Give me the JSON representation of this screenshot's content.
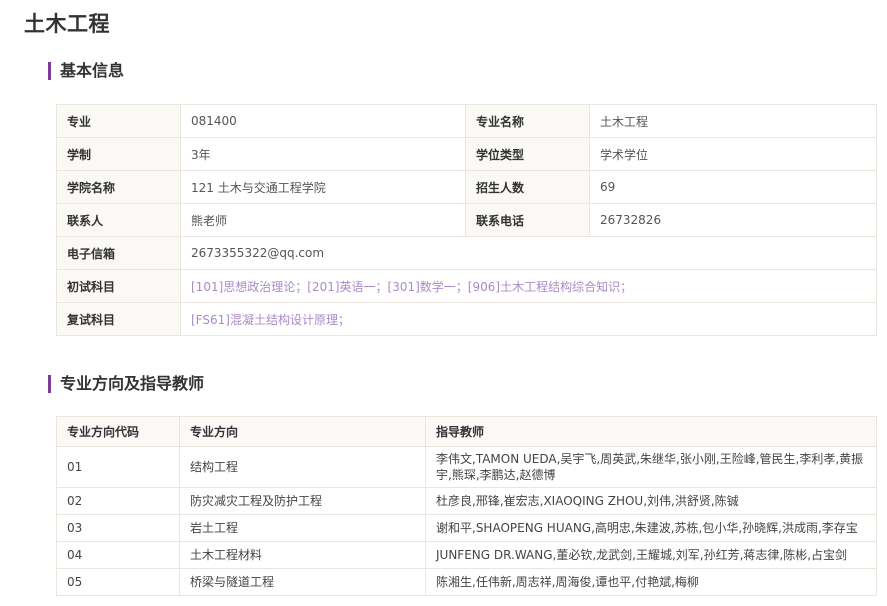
{
  "page": {
    "title": "土木工程"
  },
  "basic_info": {
    "section_title": "基本信息",
    "major_label": "专业",
    "major_value": "081400",
    "major_name_label": "专业名称",
    "major_name_value": "土木工程",
    "duration_label": "学制",
    "duration_value": "3年",
    "degree_type_label": "学位类型",
    "degree_type_value": "学术学位",
    "college_label": "学院名称",
    "college_value": "121 土木与交通工程学院",
    "enrollment_label": "招生人数",
    "enrollment_value": "69",
    "contact_label": "联系人",
    "contact_value": "熊老师",
    "phone_label": "联系电话",
    "phone_value": "26732826",
    "email_label": "电子信箱",
    "email_value": "2673355322@qq.com",
    "initial_exam_label": "初试科目",
    "initial_exam_value": "[101]思想政治理论；[201]英语一；[301]数学一；[906]土木工程结构综合知识；",
    "retest_label": "复试科目",
    "retest_value": "[FS61]混凝土结构设计原理；"
  },
  "directions": {
    "section_title": "专业方向及指导教师",
    "headers": {
      "code": "专业方向代码",
      "direction": "专业方向",
      "advisors": "指导教师"
    },
    "rows": [
      {
        "code": "01",
        "direction": "结构工程",
        "advisors": "李伟文,TAMON UEDA,吴宇飞,周英武,朱继华,张小刚,王险峰,管民生,李利孝,黄振宇,熊琛,李鹏达,赵德博"
      },
      {
        "code": "02",
        "direction": "防灾减灾工程及防护工程",
        "advisors": "杜彦良,邢锋,崔宏志,XIAOQING ZHOU,刘伟,洪舒贤,陈铖"
      },
      {
        "code": "03",
        "direction": "岩土工程",
        "advisors": "谢和平,SHAOPENG HUANG,高明忠,朱建波,苏栋,包小华,孙晓辉,洪成雨,李存宝"
      },
      {
        "code": "04",
        "direction": "土木工程材料",
        "advisors": "JUNFENG DR.WANG,董必钦,龙武剑,王耀城,刘军,孙红芳,蒋志律,陈彬,占宝剑"
      },
      {
        "code": "05",
        "direction": "桥梁与隧道工程",
        "advisors": "陈湘生,任伟新,周志祥,周海俊,谭也平,付艳斌,梅柳"
      }
    ]
  },
  "colors": {
    "accent": "#7d3c98",
    "link": "#a98bc8",
    "label_bg": "#fbf9f5",
    "border": "#ebe6dd"
  }
}
